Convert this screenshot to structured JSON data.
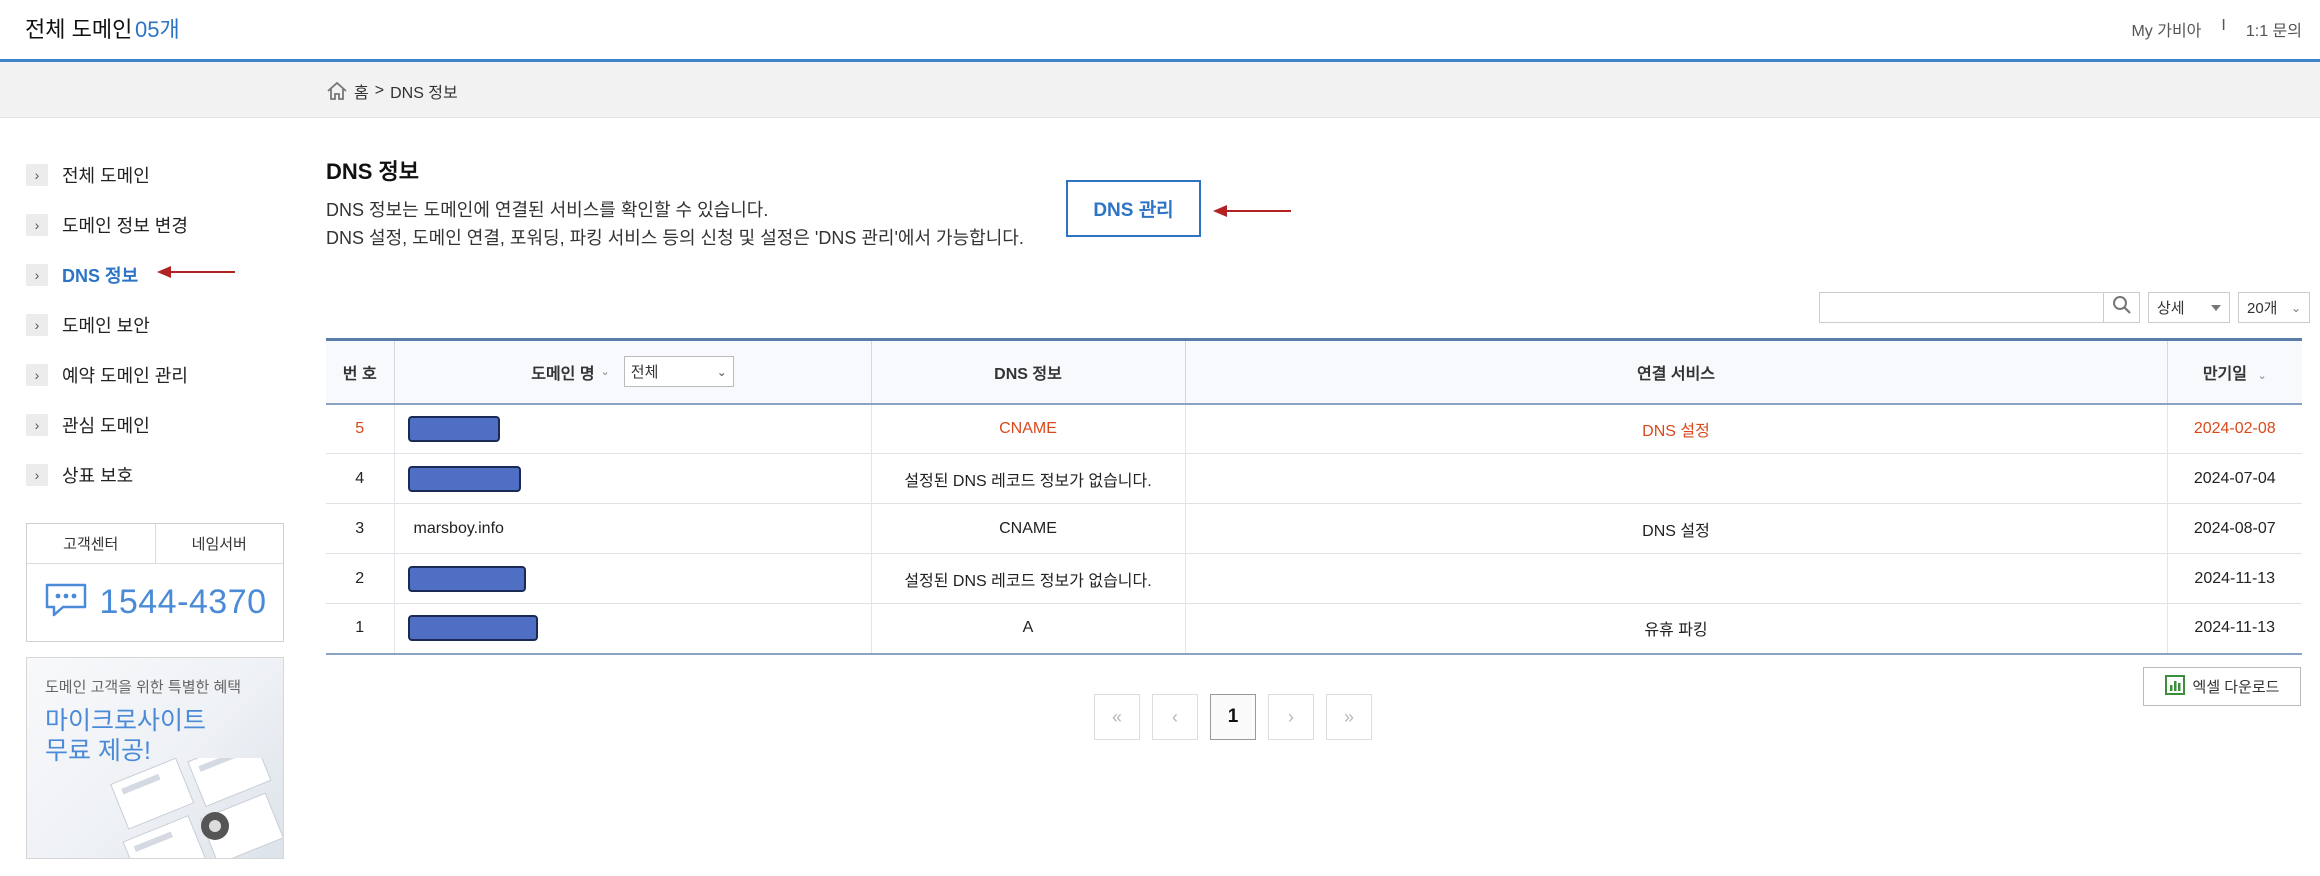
{
  "header": {
    "title": "전체 도메인",
    "count": "05개",
    "links": [
      "My 가비아",
      "I",
      "1:1 문의"
    ]
  },
  "breadcrumb": {
    "home": "홈",
    "separator": ">",
    "current": "DNS 정보"
  },
  "sidebar": {
    "items": [
      {
        "label": "전체 도메인"
      },
      {
        "label": "도메인 정보 변경"
      },
      {
        "label": "DNS 정보",
        "active": true
      },
      {
        "label": "도메인 보안"
      },
      {
        "label": "예약 도메인 관리"
      },
      {
        "label": "관심 도메인"
      },
      {
        "label": "상표 보호"
      }
    ],
    "support": {
      "tab1": "고객센터",
      "tab2": "네임서버",
      "phone": "1544-4370"
    },
    "banner": {
      "subtitle": "도메인 고객을 위한 특별한 혜택",
      "line1": "마이크로사이트",
      "line2": "무료 제공!"
    }
  },
  "main": {
    "title": "DNS 정보",
    "desc1": "DNS 정보는 도메인에 연결된 서비스를 확인할 수 있습니다.",
    "desc2": "DNS 설정, 도메인 연결, 포워딩, 파킹 서비스 등의 신청 및 설정은 'DNS 관리'에서 가능합니다.",
    "dns_button": "DNS 관리"
  },
  "search": {
    "placeholder": "",
    "detail": "상세",
    "page_size": "20개"
  },
  "table": {
    "headers": {
      "no": "번 호",
      "domain": "도메인 명",
      "domain_filter": "전체",
      "dns": "DNS 정보",
      "service": "연결 서비스",
      "expiry": "만기일"
    },
    "rows": [
      {
        "no": "5",
        "domain": "",
        "dns": "CNAME",
        "service": "DNS 설정",
        "expiry": "2024-02-08",
        "highlight": true
      },
      {
        "no": "4",
        "domain": "",
        "dns": "설정된 DNS 레코드 정보가 없습니다.",
        "service": "",
        "expiry": "2024-07-04"
      },
      {
        "no": "3",
        "domain": "marsboy.info",
        "dns": "CNAME",
        "service": "DNS 설정",
        "expiry": "2024-08-07"
      },
      {
        "no": "2",
        "domain": "",
        "dns": "설정된 DNS 레코드 정보가 없습니다.",
        "service": "",
        "expiry": "2024-11-13"
      },
      {
        "no": "1",
        "domain": "",
        "dns": "A",
        "service": "유휴 파킹",
        "expiry": "2024-11-13"
      }
    ]
  },
  "excel_button": "엑셀 다운로드",
  "pagination": {
    "current": "1"
  },
  "colors": {
    "accent": "#2d74c4",
    "highlight_row": "#d9491c",
    "annotation_arrow": "#b22222",
    "redaction": "#4e6fc4"
  }
}
